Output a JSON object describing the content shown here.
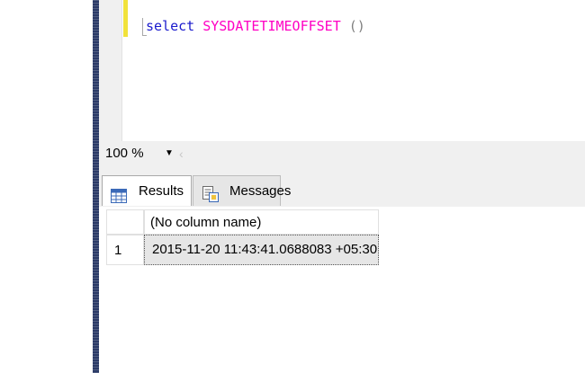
{
  "editor": {
    "keyword": "select",
    "function_name": "SYSDATETIMEOFFSET",
    "args": " ()"
  },
  "zoom": {
    "value": "100 %"
  },
  "tabs": [
    {
      "label": "Results",
      "icon": "grid-icon"
    },
    {
      "label": "Messages",
      "icon": "messages-icon"
    }
  ],
  "grid": {
    "column_header": "(No column name)",
    "rows": [
      {
        "row_number": "1",
        "value": "2015-11-20 11:43:41.0688083 +05:30"
      }
    ]
  },
  "colors": {
    "keyword": "#1a1acd",
    "function": "#ff00c4",
    "sidebar": "#2b3a67",
    "change_marker": "#f1e23b"
  }
}
